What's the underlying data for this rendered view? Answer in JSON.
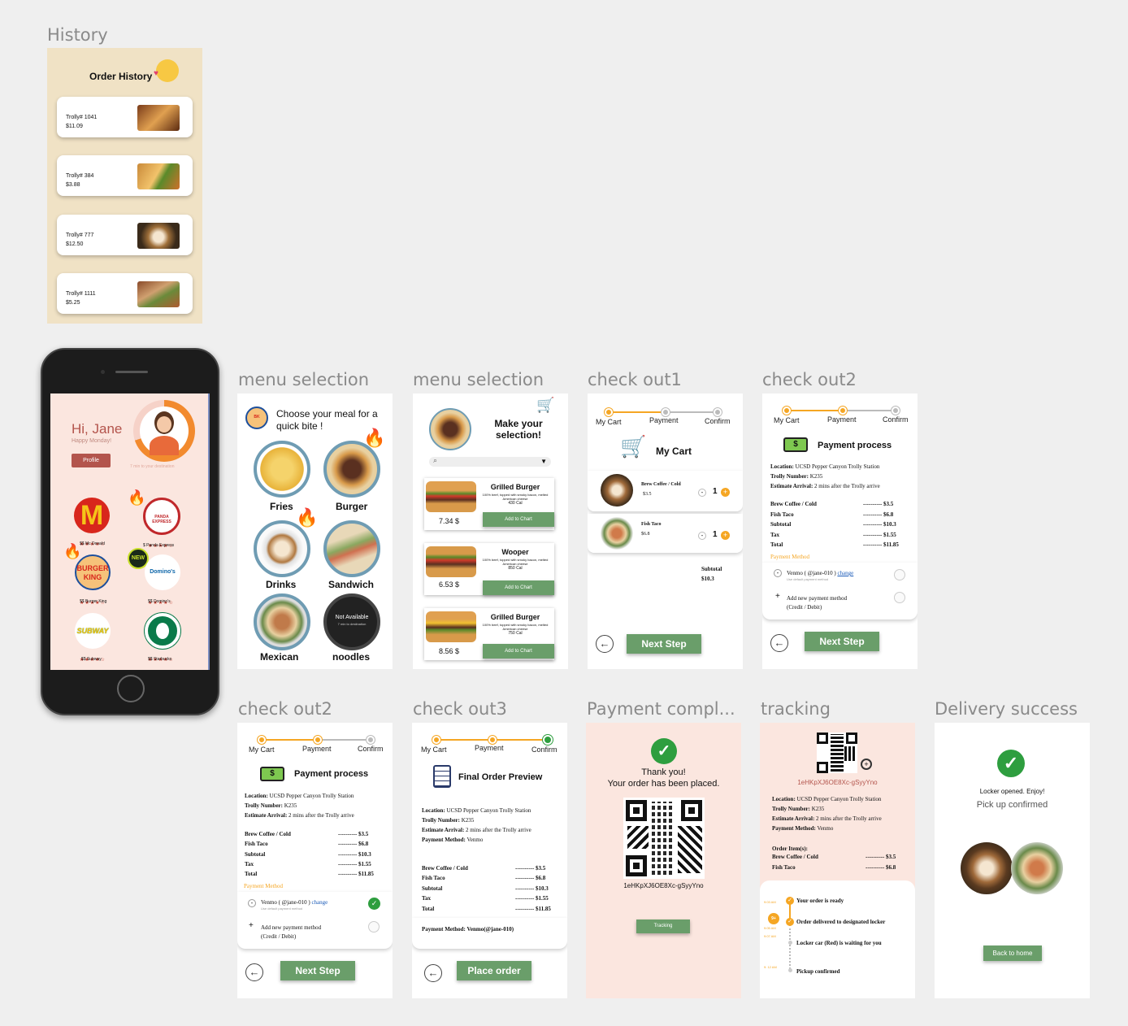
{
  "frames": {
    "history": "History",
    "menu1": "menu selection",
    "menu2": "menu selection",
    "checkout1": "check out1",
    "checkout2a": "check out2",
    "checkout2b": "check out2",
    "checkout3": "check out3",
    "payment_complete": "Payment compl...",
    "tracking": "tracking",
    "delivery": "Delivery success"
  },
  "history": {
    "title": "Order History",
    "orders": [
      {
        "id": "Trolly# 1041",
        "price": "$11.09"
      },
      {
        "id": "Trolly# 384",
        "price": "$3.88"
      },
      {
        "id": "Trolly# 777",
        "price": "$12.50"
      },
      {
        "id": "Trolly# 1111",
        "price": "$5.25"
      }
    ]
  },
  "home": {
    "greeting": "Hi, Jane",
    "subtitle": "Happy Monday!",
    "profile_button": "Profile",
    "ring_caption": "7 min to your destination",
    "restaurants": [
      {
        "name": "$$ Mc Donald",
        "rating": "★★★★☆"
      },
      {
        "name": "$ Panda Express",
        "rating": "★★★★☆"
      },
      {
        "name": "$$ Burger King",
        "rating": "★★★★☆"
      },
      {
        "name": "$$ Domino's",
        "rating": "★★★★☆"
      },
      {
        "name": "$$ Subway",
        "rating": "★★★★☆"
      },
      {
        "name": "$$ Starbucks",
        "rating": "★★★★☆"
      }
    ],
    "logo_text": {
      "bk": "BURGER KING",
      "panda": "PANDA EXPRESS",
      "dominos": "Domino's",
      "subway": "SUBWAY",
      "new_badge": "NEW"
    }
  },
  "menu1": {
    "title": "Choose your meal for a quick bite !",
    "categories": [
      "Fries",
      "Burger",
      "Drinks",
      "Sandwich",
      "Mexican",
      "noodles"
    ],
    "not_available": "Not Available",
    "not_available_sub": "7 min to destination"
  },
  "menu2": {
    "title": "Make your selection!",
    "items": [
      {
        "name": "Grilled Burger",
        "desc": "100% beef, topped with smoky bacon, melted American cheese",
        "cal": "430 Cal",
        "price": "7.34 $",
        "button": "Add to Chart"
      },
      {
        "name": "Wooper",
        "desc": "100% beef, topped with smoky bacon, melted American cheese",
        "cal": "850 Cal",
        "price": "6.53 $",
        "button": "Add to Chart"
      },
      {
        "name": "Grilled Burger",
        "desc": "100% beef, topped with smoky bacon, melted American cheese",
        "cal": "750 Cal",
        "price": "8.56 $",
        "button": "Add to Chart"
      }
    ]
  },
  "steps": [
    "My Cart",
    "Payment",
    "Confirm"
  ],
  "checkout1": {
    "title": "My Cart",
    "items": [
      {
        "name": "Brew Coffee / Cold",
        "price": "$3.5",
        "qty": "1"
      },
      {
        "name": "Fish Taco",
        "price": "$6.8",
        "qty": "1"
      }
    ],
    "subtotal_label": "Subtotal",
    "subtotal": "$10.3",
    "next": "Next Step"
  },
  "order_info": {
    "location_label": "Location:",
    "location": "UCSD Pepper Canyon Trolly Station",
    "trolly_label": "Trolly Number:",
    "trolly": "K235",
    "arrival_label": "Estimate Arrival:",
    "arrival": "2 mins after the Trolly arrive",
    "method_label": "Payment Method:",
    "method": "Venmo"
  },
  "summary": [
    {
      "label": "Brew Coffee / Cold",
      "value": "---------- $3.5"
    },
    {
      "label": "Fish Taco",
      "value": "---------- $6.8"
    },
    {
      "label": "Subtotal",
      "value": "---------- $10.3"
    },
    {
      "label": "Tax",
      "value": "---------- $1.55"
    },
    {
      "label": "Total",
      "value": "---------- $11.85"
    }
  ],
  "payment": {
    "title": "Payment process",
    "method_heading": "Payment Method",
    "venmo": "Venmo ( @jane-010 )",
    "change": "change",
    "default_note": "Use default payment method",
    "add_method": "Add new payment method",
    "add_method_sub": "(Credit / Debit)",
    "next": "Next Step"
  },
  "checkout3": {
    "title": "Final Order Preview",
    "method_line_label": "Payment Method:",
    "method_line": "Venmo(@jane-010)",
    "place": "Place order"
  },
  "complete": {
    "line1": "Thank you!",
    "line2": "Your order has been placed.",
    "code": "1eHKpXJ6OE8Xc-gSyyYno",
    "tracking": "Tracking"
  },
  "tracking": {
    "code": "1eHKpXJ6OE8Xc-gSyyYno",
    "items_label": "Order Item(s):",
    "item1": "Brew Coffee / Cold",
    "item1_val": "---------- $3.5",
    "item2": "Fish Taco",
    "item2_val": "---------- $6.8",
    "timeline": [
      {
        "time": "9:03 AM",
        "text": "Your order is ready"
      },
      {
        "time": "9:05 AM",
        "text": "Order delivered to designated locker"
      },
      {
        "time": "9:07 AM",
        "text": "Locker car (Red) is waiting for you"
      },
      {
        "time": "9: 12 AM",
        "text": "Pickup confirmed"
      }
    ],
    "badge": "9+"
  },
  "delivery": {
    "line1": "Locker opened. Enjoy!",
    "line2": "Pick up confirmed",
    "home": "Back to home"
  },
  "colors": {
    "green": "#6a9e6a",
    "orange": "#f5a623",
    "peach": "#fbe6df",
    "tan": "#f0e2c5"
  }
}
